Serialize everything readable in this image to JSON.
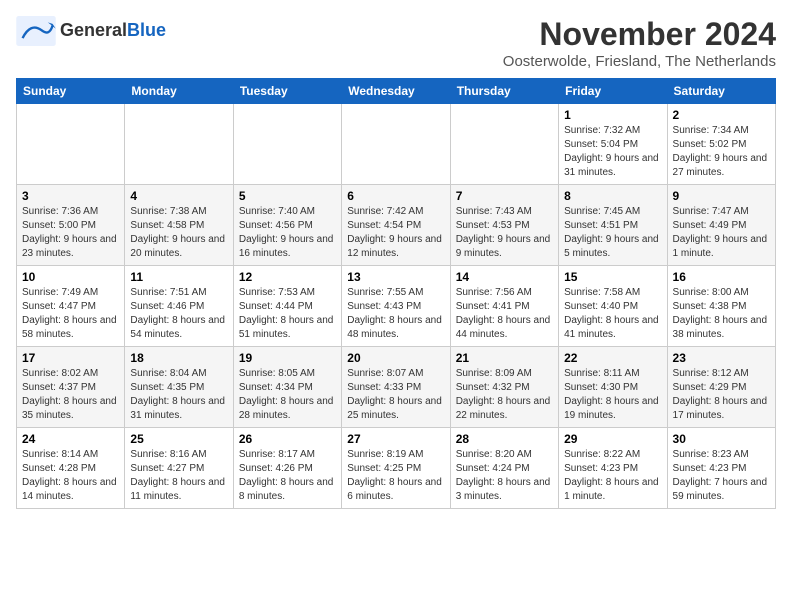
{
  "header": {
    "logo_line1": "General",
    "logo_line2": "Blue",
    "month": "November 2024",
    "location": "Oosterwolde, Friesland, The Netherlands"
  },
  "weekdays": [
    "Sunday",
    "Monday",
    "Tuesday",
    "Wednesday",
    "Thursday",
    "Friday",
    "Saturday"
  ],
  "weeks": [
    [
      {
        "day": "",
        "info": ""
      },
      {
        "day": "",
        "info": ""
      },
      {
        "day": "",
        "info": ""
      },
      {
        "day": "",
        "info": ""
      },
      {
        "day": "",
        "info": ""
      },
      {
        "day": "1",
        "info": "Sunrise: 7:32 AM\nSunset: 5:04 PM\nDaylight: 9 hours and 31 minutes."
      },
      {
        "day": "2",
        "info": "Sunrise: 7:34 AM\nSunset: 5:02 PM\nDaylight: 9 hours and 27 minutes."
      }
    ],
    [
      {
        "day": "3",
        "info": "Sunrise: 7:36 AM\nSunset: 5:00 PM\nDaylight: 9 hours and 23 minutes."
      },
      {
        "day": "4",
        "info": "Sunrise: 7:38 AM\nSunset: 4:58 PM\nDaylight: 9 hours and 20 minutes."
      },
      {
        "day": "5",
        "info": "Sunrise: 7:40 AM\nSunset: 4:56 PM\nDaylight: 9 hours and 16 minutes."
      },
      {
        "day": "6",
        "info": "Sunrise: 7:42 AM\nSunset: 4:54 PM\nDaylight: 9 hours and 12 minutes."
      },
      {
        "day": "7",
        "info": "Sunrise: 7:43 AM\nSunset: 4:53 PM\nDaylight: 9 hours and 9 minutes."
      },
      {
        "day": "8",
        "info": "Sunrise: 7:45 AM\nSunset: 4:51 PM\nDaylight: 9 hours and 5 minutes."
      },
      {
        "day": "9",
        "info": "Sunrise: 7:47 AM\nSunset: 4:49 PM\nDaylight: 9 hours and 1 minute."
      }
    ],
    [
      {
        "day": "10",
        "info": "Sunrise: 7:49 AM\nSunset: 4:47 PM\nDaylight: 8 hours and 58 minutes."
      },
      {
        "day": "11",
        "info": "Sunrise: 7:51 AM\nSunset: 4:46 PM\nDaylight: 8 hours and 54 minutes."
      },
      {
        "day": "12",
        "info": "Sunrise: 7:53 AM\nSunset: 4:44 PM\nDaylight: 8 hours and 51 minutes."
      },
      {
        "day": "13",
        "info": "Sunrise: 7:55 AM\nSunset: 4:43 PM\nDaylight: 8 hours and 48 minutes."
      },
      {
        "day": "14",
        "info": "Sunrise: 7:56 AM\nSunset: 4:41 PM\nDaylight: 8 hours and 44 minutes."
      },
      {
        "day": "15",
        "info": "Sunrise: 7:58 AM\nSunset: 4:40 PM\nDaylight: 8 hours and 41 minutes."
      },
      {
        "day": "16",
        "info": "Sunrise: 8:00 AM\nSunset: 4:38 PM\nDaylight: 8 hours and 38 minutes."
      }
    ],
    [
      {
        "day": "17",
        "info": "Sunrise: 8:02 AM\nSunset: 4:37 PM\nDaylight: 8 hours and 35 minutes."
      },
      {
        "day": "18",
        "info": "Sunrise: 8:04 AM\nSunset: 4:35 PM\nDaylight: 8 hours and 31 minutes."
      },
      {
        "day": "19",
        "info": "Sunrise: 8:05 AM\nSunset: 4:34 PM\nDaylight: 8 hours and 28 minutes."
      },
      {
        "day": "20",
        "info": "Sunrise: 8:07 AM\nSunset: 4:33 PM\nDaylight: 8 hours and 25 minutes."
      },
      {
        "day": "21",
        "info": "Sunrise: 8:09 AM\nSunset: 4:32 PM\nDaylight: 8 hours and 22 minutes."
      },
      {
        "day": "22",
        "info": "Sunrise: 8:11 AM\nSunset: 4:30 PM\nDaylight: 8 hours and 19 minutes."
      },
      {
        "day": "23",
        "info": "Sunrise: 8:12 AM\nSunset: 4:29 PM\nDaylight: 8 hours and 17 minutes."
      }
    ],
    [
      {
        "day": "24",
        "info": "Sunrise: 8:14 AM\nSunset: 4:28 PM\nDaylight: 8 hours and 14 minutes."
      },
      {
        "day": "25",
        "info": "Sunrise: 8:16 AM\nSunset: 4:27 PM\nDaylight: 8 hours and 11 minutes."
      },
      {
        "day": "26",
        "info": "Sunrise: 8:17 AM\nSunset: 4:26 PM\nDaylight: 8 hours and 8 minutes."
      },
      {
        "day": "27",
        "info": "Sunrise: 8:19 AM\nSunset: 4:25 PM\nDaylight: 8 hours and 6 minutes."
      },
      {
        "day": "28",
        "info": "Sunrise: 8:20 AM\nSunset: 4:24 PM\nDaylight: 8 hours and 3 minutes."
      },
      {
        "day": "29",
        "info": "Sunrise: 8:22 AM\nSunset: 4:23 PM\nDaylight: 8 hours and 1 minute."
      },
      {
        "day": "30",
        "info": "Sunrise: 8:23 AM\nSunset: 4:23 PM\nDaylight: 7 hours and 59 minutes."
      }
    ]
  ]
}
